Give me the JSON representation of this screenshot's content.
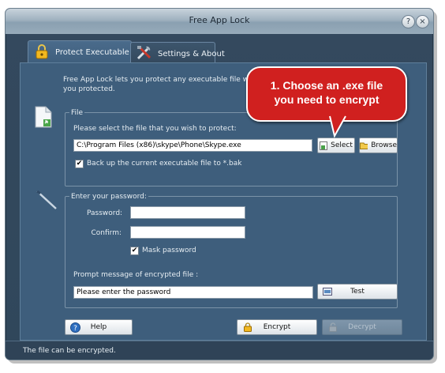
{
  "window": {
    "title": "Free App Lock"
  },
  "title_buttons": {
    "help": "?",
    "close": "×"
  },
  "tabs": [
    {
      "label": "Protect Executable File",
      "icon": "padlock-icon"
    },
    {
      "label": "Settings & About",
      "icon": "tools-icon"
    }
  ],
  "intro": {
    "line1": "Free App Lock lets you protect any executable file with a secure",
    "line2": "you protected."
  },
  "file_group": {
    "title": "File",
    "instruction": "Please select the file that you wish to protect:",
    "path_value": "C:\\Program Files (x86)\\skype\\Phone\\Skype.exe",
    "select_label": "Select",
    "browse_label": "Browse",
    "backup_label": "Back up the current executable file to *.bak",
    "backup_checked": "✔"
  },
  "password_group": {
    "title": "Enter your password:",
    "password_label": "Password:",
    "confirm_label": "Confirm:",
    "password_value": "",
    "confirm_value": "",
    "mask_label": "Mask password",
    "mask_checked": "✔",
    "prompt_label": "Prompt message of encrypted file :",
    "prompt_value": "Please enter the password",
    "test_label": "Test"
  },
  "buttons": {
    "help": "Help",
    "encrypt": "Encrypt",
    "decrypt": "Decrypt"
  },
  "status": {
    "text": "The file can be encrypted."
  },
  "callout": {
    "line1": "1. Choose an .exe file",
    "line2": "you need to encrypt"
  },
  "colors": {
    "callout_red": "#d0201f",
    "panel_blue": "#3e5e7c",
    "window_bg": "#34495e"
  }
}
